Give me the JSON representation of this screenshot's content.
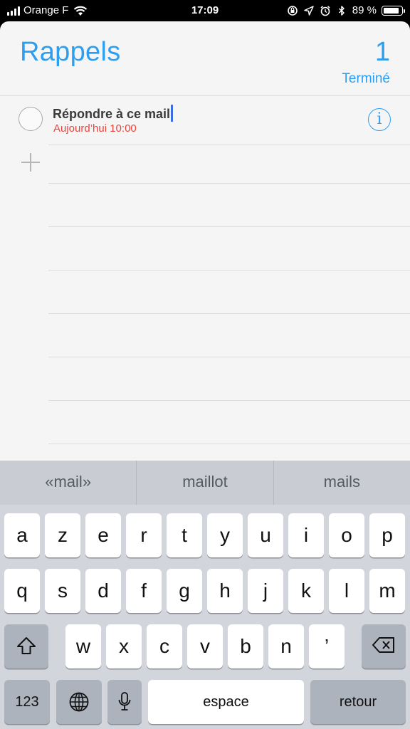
{
  "status": {
    "carrier": "Orange F",
    "time": "17:09",
    "battery_text": "89 %",
    "battery_level": 0.89,
    "icons": [
      "signal-icon",
      "wifi-icon",
      "screen-lock-icon",
      "location-icon",
      "alarm-icon",
      "bluetooth-icon",
      "battery-icon"
    ]
  },
  "header": {
    "title": "Rappels",
    "completed_count": "1",
    "done_label": "Terminé"
  },
  "reminder": {
    "title": "Répondre à ce mail",
    "due": "Aujourd’hui 10:00"
  },
  "keyboard": {
    "suggestions": [
      "«mail»",
      "maillot",
      "mails"
    ],
    "row1": [
      "a",
      "z",
      "e",
      "r",
      "t",
      "y",
      "u",
      "i",
      "o",
      "p"
    ],
    "row2": [
      "q",
      "s",
      "d",
      "f",
      "g",
      "h",
      "j",
      "k",
      "l",
      "m"
    ],
    "row3": [
      "w",
      "x",
      "c",
      "v",
      "b",
      "n",
      "’"
    ],
    "numbers_label": "123",
    "space_label": "espace",
    "return_label": "retour"
  },
  "colors": {
    "accent": "#2d9ef0",
    "due_red": "#e8453c",
    "caret": "#3b6fe0"
  }
}
